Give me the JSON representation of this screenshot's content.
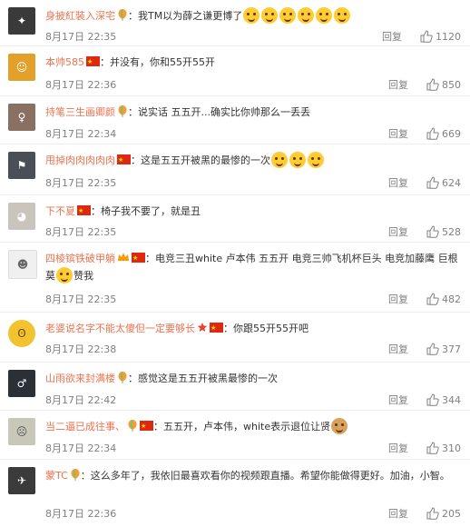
{
  "comments": [
    {
      "name": "身披紅裝入深宅",
      "text": "：我TM以为薛之谦更博了",
      "date": "8月17日 22:35",
      "likes": "1120",
      "avatar_color": "#3a3a3a"
    },
    {
      "name": "本帅585",
      "text": "：并没有，你和55开55开",
      "date": "8月17日 22:36",
      "likes": "850",
      "avatar_color": "#e3a02b"
    },
    {
      "name": "持笔三生画卿颜",
      "text": "：说实话 五五开...确实比你帅那么一丢丢",
      "date": "8月17日 22:34",
      "likes": "669",
      "avatar_color": "#8a6f63"
    },
    {
      "name": "甩掉肉肉肉肉肉",
      "text": "：这是五五开被黑的最惨的一次",
      "date": "8月17日 22:35",
      "likes": "624",
      "avatar_color": "#4a4f57"
    },
    {
      "name": "下不夏",
      "text": "：椅子我不要了，就是丑",
      "date": "8月17日 22:35",
      "likes": "528",
      "avatar_color": "#c9c4bc"
    },
    {
      "name": "四棱镔铁破甲躺",
      "text": "：电竞三丑white 卢本伟 五五开 电竞三帅飞机杯巨头 电竞加藤鹰 巨根莫",
      "text2": "赞我",
      "date": "8月17日 22:35",
      "likes": "482",
      "avatar_color": "#f0f0f0"
    },
    {
      "name": "老婆说名字不能太傻但一定要够长",
      "text": "：你跟55开55开吧",
      "date": "8月17日 22:38",
      "likes": "377",
      "avatar_color": "#f2c230"
    },
    {
      "name": "山雨欲来封满楼",
      "text": "：感觉这是五五开被黑最惨的一次",
      "date": "8月17日 22:42",
      "likes": "344",
      "avatar_color": "#2b2f36"
    },
    {
      "name": "当二逼已成往事、",
      "text": "：五五开，卢本伟，white表示退位让贤",
      "date": "8月17日 22:34",
      "likes": "310",
      "avatar_color": "#c8c8b8"
    },
    {
      "name": "蒙TC",
      "text": "：这么多年了，我依旧最喜欢看你的视频跟直播。希望你能做得更好。加油，小智。",
      "date": "8月17日 22:36",
      "likes": "205",
      "avatar_color": "#3b3b3b"
    }
  ],
  "reply_label": "回复",
  "colors": {
    "name": "#eb7350",
    "meta": "#808080"
  }
}
